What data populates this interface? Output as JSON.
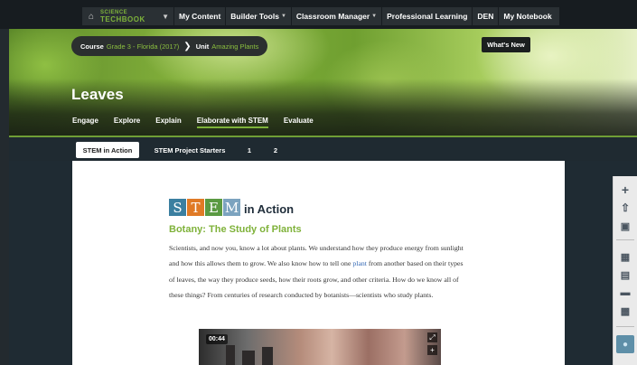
{
  "nav": {
    "brand_top": "SCIENCE",
    "brand_bottom": "TECHBOOK",
    "items": [
      "My Content",
      "Builder Tools",
      "Classroom Manager",
      "Professional Learning",
      "DEN",
      "My Notebook"
    ]
  },
  "hero": {
    "breadcrumb_course_label": "Course",
    "breadcrumb_course_value": "Grade 3 - Florida (2017)",
    "breadcrumb_unit_label": "Unit",
    "breadcrumb_unit_value": "Amazing Plants",
    "whats_new": "What's New",
    "title": "Leaves",
    "tabs": [
      "Engage",
      "Explore",
      "Explain",
      "Elaborate with STEM",
      "Evaluate"
    ]
  },
  "subtabs": [
    "STEM in Action",
    "STEM Project Starters",
    "1",
    "2"
  ],
  "content": {
    "stem_letters": [
      "S",
      "T",
      "E",
      "M"
    ],
    "stem_suffix": "in Action",
    "subtitle": "Botany: The Study of Plants",
    "para_before_link": "Scientists, and now you, know a lot about plants. We understand how they produce energy from sunlight and how this allows them to grow. We also know how to tell one ",
    "para_link": "plant",
    "para_after_link": " from another based on their types of leaves, the way they produce seeds, how their roots grow, and other criteria. How do we know all of these things? From centuries of research conducted by botanists—scientists who study plants.",
    "video_time": "00:44"
  },
  "colors": {
    "accent_green": "#7fb23a",
    "link_blue": "#3569b5"
  }
}
